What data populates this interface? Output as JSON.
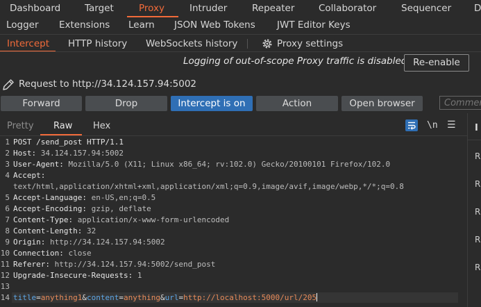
{
  "colors": {
    "accent": "#f26b3a",
    "primary_button": "#2f6fb5",
    "param_name": "#5ea7e6",
    "param_value": "#e78b5a"
  },
  "top_tabs_row1": [
    "Dashboard",
    "Target",
    "Proxy",
    "Intruder",
    "Repeater",
    "Collaborator",
    "Sequencer",
    "D"
  ],
  "top_tabs_row2": [
    "Logger",
    "Extensions",
    "Learn",
    "JSON Web Tokens",
    "JWT Editor Keys"
  ],
  "proxy_tabs": {
    "intercept": "Intercept",
    "http_history": "HTTP history",
    "websockets_history": "WebSockets history",
    "settings": "Proxy settings"
  },
  "notice": {
    "text": "Logging of out-of-scope Proxy traffic is disabled",
    "button": "Re-enable"
  },
  "request_target": "Request to http://34.124.157.94:5002",
  "toolbar": {
    "forward": "Forward",
    "drop": "Drop",
    "intercept": "Intercept is on",
    "action": "Action",
    "open_browser": "Open browser",
    "comment_placeholder": "Commer"
  },
  "editor_tabs": {
    "pretty": "Pretty",
    "raw": "Raw",
    "hex": "Hex",
    "newline_toggle": "\\n"
  },
  "request": {
    "request_line": "POST /send_post HTTP/1.1",
    "headers": [
      {
        "name": "Host",
        "value": "34.124.157.94:5002"
      },
      {
        "name": "User-Agent",
        "value": "Mozilla/5.0 (X11; Linux x86_64; rv:102.0) Gecko/20100101 Firefox/102.0"
      },
      {
        "name": "Accept",
        "value": ""
      },
      {
        "name": "",
        "value": "text/html,application/xhtml+xml,application/xml;q=0.9,image/avif,image/webp,*/*;q=0.8"
      },
      {
        "name": "Accept-Language",
        "value": "en-US,en;q=0.5"
      },
      {
        "name": "Accept-Encoding",
        "value": "gzip, deflate"
      },
      {
        "name": "Content-Type",
        "value": "application/x-www-form-urlencoded"
      },
      {
        "name": "Content-Length",
        "value": "32"
      },
      {
        "name": "Origin",
        "value": "http://34.124.157.94:5002"
      },
      {
        "name": "Connection",
        "value": "close"
      },
      {
        "name": "Referer",
        "value": "http://34.124.157.94:5002/send_post"
      },
      {
        "name": "Upgrade-Insecure-Requests",
        "value": "1"
      }
    ],
    "line_numbers": [
      "1",
      "2",
      "3",
      "4",
      "",
      "5",
      "6",
      "7",
      "8",
      "9",
      "10",
      "11",
      "12",
      "13",
      "14"
    ],
    "body_params": [
      {
        "name": "title",
        "value": "anything1"
      },
      {
        "name": "content",
        "value": "anything"
      },
      {
        "name": "url",
        "value": "http://localhost:5000/url/205"
      }
    ]
  },
  "inspector": {
    "header": "I",
    "items": [
      "R",
      "R",
      "R",
      "R",
      "R"
    ]
  }
}
